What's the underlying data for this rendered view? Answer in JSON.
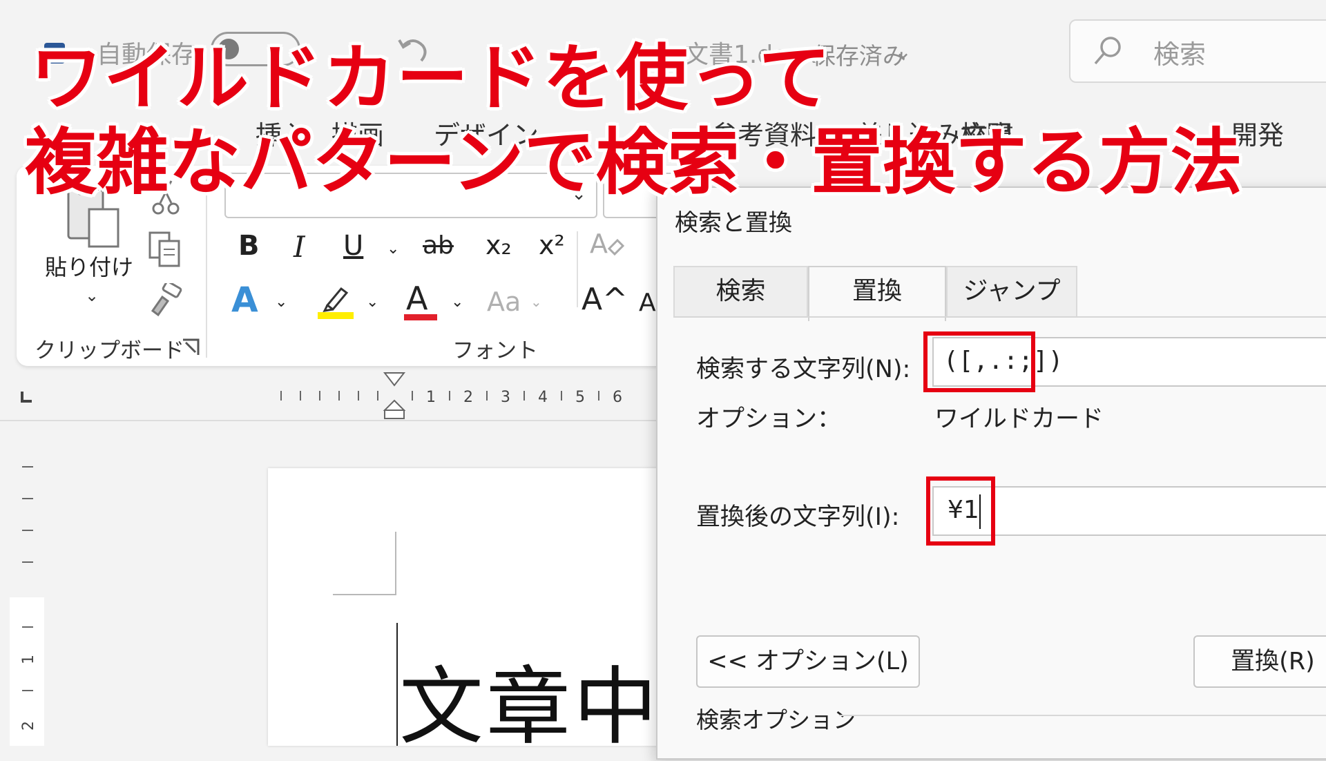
{
  "headline": {
    "line1": "ワイルドカードを使って",
    "line2": "複雑なパターンで検索・置換する方法"
  },
  "titlebar": {
    "autosave_label": "自動保存",
    "doc_name": "文書1.docx",
    "save_status": "• 保存済み",
    "search_placeholder": "検索"
  },
  "ribbon_tabs": {
    "insert": "挿入",
    "draw": "描画",
    "design": "デザイン",
    "references": "参考資料",
    "mailings": "差し込み文書",
    "review": "校閲",
    "developer": "開発"
  },
  "ribbon": {
    "paste_label": "貼り付け",
    "clipboard_group": "クリップボード",
    "font_group": "フォント",
    "bold": "B",
    "italic": "I",
    "underline": "U",
    "strikethrough": "ab",
    "subscript": "x₂",
    "superscript": "x²",
    "text_effects": "A",
    "font_color": "A",
    "change_case": "Aa",
    "grow_font": "A^",
    "shrink_font": "A"
  },
  "ruler": {
    "labels": [
      "1",
      "2",
      "3",
      "4",
      "5",
      "6"
    ],
    "vertical_labels": [
      "1",
      "2"
    ]
  },
  "document": {
    "text": "文章中"
  },
  "dialog": {
    "title": "検索と置換",
    "tabs": {
      "find": "検索",
      "replace": "置換",
      "goto": "ジャンプ"
    },
    "find_label": "検索する文字列(N):",
    "find_value": "([,.:;])",
    "options_label": "オプション：",
    "options_value": "ワイルドカード",
    "replace_label": "置換後の文字列(I):",
    "replace_value": "¥1",
    "less_options_button": "<< オプション(L)",
    "replace_button": "置換(R)",
    "search_options_label": "検索オプション"
  },
  "colors": {
    "headline": "#e60012",
    "highlight_box": "#e60012",
    "font_color_bar": "#e2202b",
    "highlighter": "#ffee00",
    "text_effects": "#3a8fd6",
    "word_blue": "#2b5797"
  }
}
